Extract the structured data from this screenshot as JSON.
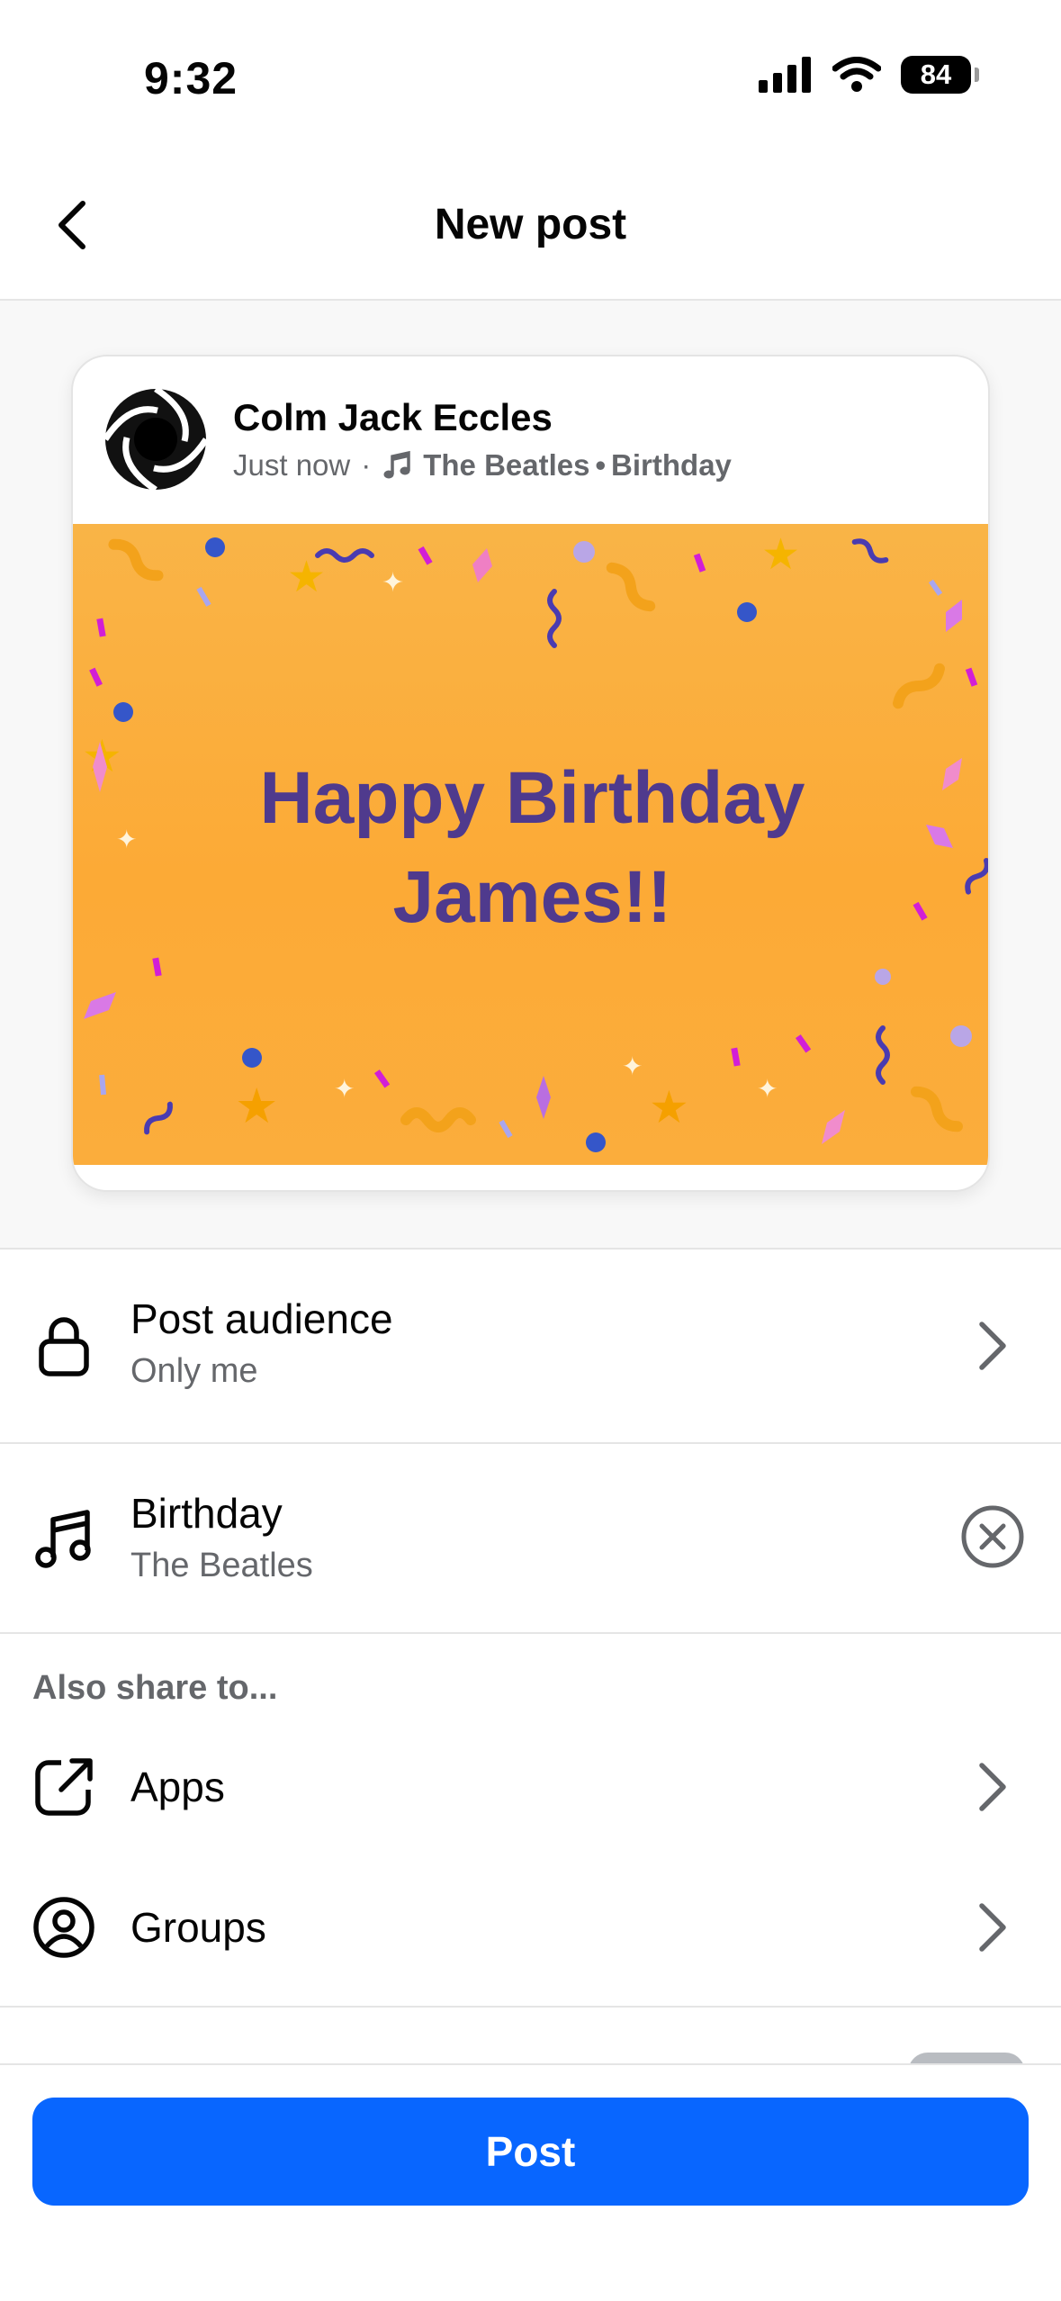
{
  "status_bar": {
    "time": "9:32",
    "battery": "84"
  },
  "header": {
    "title": "New post"
  },
  "post_preview": {
    "author": "Colm Jack Eccles",
    "time": "Just now",
    "separator": "·",
    "song_artist": "The Beatles",
    "song_dot": "•",
    "song_title": "Birthday",
    "banner_line1": "Happy Birthday",
    "banner_line2": "James!!",
    "banner_text_color": "#4f3a8d",
    "banner_bg_color": "#fbad3c"
  },
  "settings": {
    "audience": {
      "title": "Post audience",
      "value": "Only me",
      "icon": "lock-icon"
    },
    "music": {
      "title": "Birthday",
      "artist": "The Beatles",
      "icon": "music-note-icon"
    }
  },
  "also_share": {
    "label": "Also share to...",
    "items": [
      {
        "label": "Apps",
        "icon": "share-external-icon"
      },
      {
        "label": "Groups",
        "icon": "groups-icon"
      }
    ]
  },
  "footer": {
    "post_label": "Post",
    "accent": "#0866ff"
  }
}
